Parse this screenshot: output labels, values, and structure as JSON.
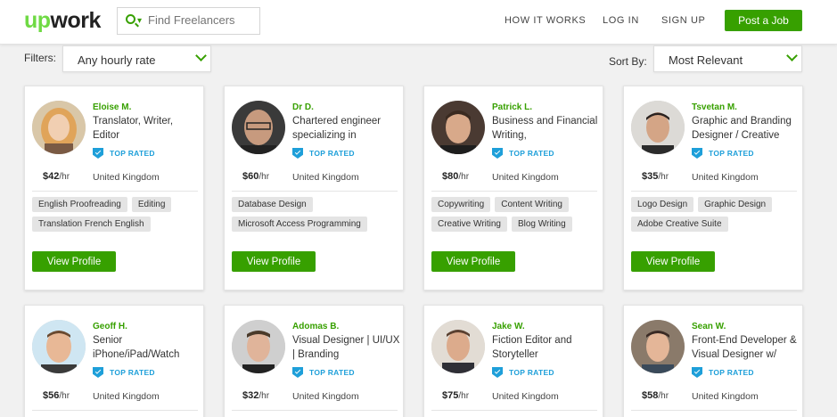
{
  "header": {
    "logo_text": "upwork",
    "search_placeholder": "Find Freelancers",
    "nav": [
      "HOW IT WORKS",
      "LOG IN",
      "SIGN UP"
    ],
    "post_job_label": "Post a Job"
  },
  "filters": {
    "label": "Filters:",
    "rate_value": "Any hourly rate",
    "sort_label": "Sort By:",
    "sort_value": "Most Relevant"
  },
  "colors": {
    "accent": "#37a000",
    "top_rated": "#1e9fd9"
  },
  "badge_label": "TOP RATED",
  "view_profile_label": "View Profile",
  "rate_unit": "/hr",
  "freelancers": [
    {
      "name": "Eloise M.",
      "title": "Translator, Writer, Editor",
      "rate": "$42",
      "country": "United Kingdom",
      "skills": [
        "English Proofreading",
        "Editing",
        "Translation French English"
      ]
    },
    {
      "name": "Dr D.",
      "title": "Chartered engineer specializing in",
      "rate": "$60",
      "country": "United Kingdom",
      "skills": [
        "Database Design",
        "Microsoft Access Programming"
      ]
    },
    {
      "name": "Patrick L.",
      "title": "Business and Financial Writing,",
      "rate": "$80",
      "country": "United Kingdom",
      "skills": [
        "Copywriting",
        "Content Writing",
        "Creative Writing",
        "Blog Writing"
      ]
    },
    {
      "name": "Tsvetan M.",
      "title": "Graphic and Branding Designer / Creative",
      "rate": "$35",
      "country": "United Kingdom",
      "skills": [
        "Logo Design",
        "Graphic Design",
        "Adobe Creative Suite"
      ]
    },
    {
      "name": "Geoff H.",
      "title": "Senior iPhone/iPad/Watch",
      "rate": "$56",
      "country": "United Kingdom",
      "skills": []
    },
    {
      "name": "Adomas B.",
      "title": "Visual Designer | UI/UX | Branding",
      "rate": "$32",
      "country": "United Kingdom",
      "skills": []
    },
    {
      "name": "Jake W.",
      "title": "Fiction Editor and Storyteller",
      "rate": "$75",
      "country": "United Kingdom",
      "skills": []
    },
    {
      "name": "Sean W.",
      "title": "Front-End Developer & Visual Designer w/",
      "rate": "$58",
      "country": "United Kingdom",
      "skills": []
    }
  ]
}
